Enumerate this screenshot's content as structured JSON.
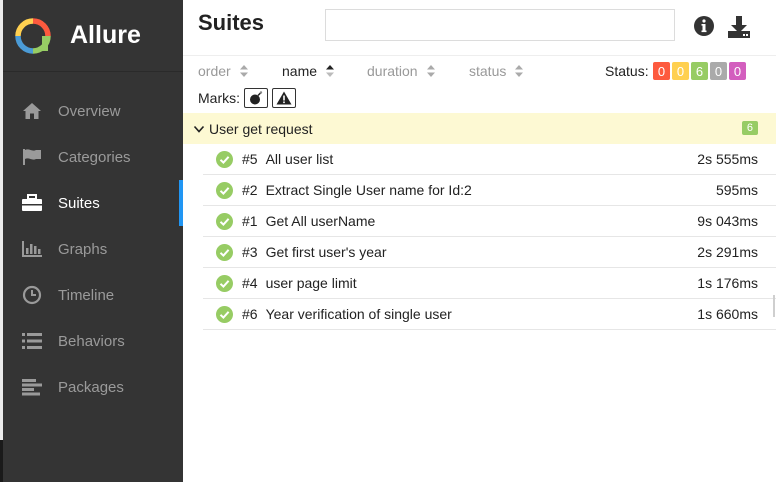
{
  "app": {
    "brand": "Allure"
  },
  "sidebar": {
    "items": [
      {
        "label": "Overview",
        "icon": "home-icon",
        "active": false
      },
      {
        "label": "Categories",
        "icon": "flag-icon",
        "active": false
      },
      {
        "label": "Suites",
        "icon": "briefcase-icon",
        "active": true
      },
      {
        "label": "Graphs",
        "icon": "bar-chart-icon",
        "active": false
      },
      {
        "label": "Timeline",
        "icon": "clock-icon",
        "active": false
      },
      {
        "label": "Behaviors",
        "icon": "list-icon",
        "active": false
      },
      {
        "label": "Packages",
        "icon": "align-left-icon",
        "active": false
      }
    ]
  },
  "header": {
    "title": "Suites",
    "search_value": ""
  },
  "toolbar": {
    "sort": [
      {
        "label": "order",
        "active": false
      },
      {
        "label": "name",
        "active": true
      },
      {
        "label": "duration",
        "active": false
      },
      {
        "label": "status",
        "active": false
      }
    ],
    "status_label": "Status:",
    "status_counts": [
      {
        "status": "failed",
        "count": "0",
        "color": "#fd5a3e"
      },
      {
        "status": "broken",
        "count": "0",
        "color": "#ffd050"
      },
      {
        "status": "passed",
        "count": "6",
        "color": "#97cc64"
      },
      {
        "status": "skipped",
        "count": "0",
        "color": "#aaaaaa"
      },
      {
        "status": "unknown",
        "count": "0",
        "color": "#d35ebe"
      }
    ],
    "marks_label": "Marks:"
  },
  "suite": {
    "name": "User get request",
    "count": "6",
    "tests": [
      {
        "num": "#5",
        "name": "All user list",
        "duration": "2s 555ms"
      },
      {
        "num": "#2",
        "name": "Extract Single User name for Id:2",
        "duration": "595ms"
      },
      {
        "num": "#1",
        "name": "Get All userName",
        "duration": "9s 043ms"
      },
      {
        "num": "#3",
        "name": "Get first user's year",
        "duration": "2s 291ms"
      },
      {
        "num": "#4",
        "name": "user page limit",
        "duration": "1s 176ms"
      },
      {
        "num": "#6",
        "name": "Year verification of single user",
        "duration": "1s 660ms"
      }
    ]
  },
  "colors": {
    "sidebar_bg": "#343434",
    "accent": "#2196f3",
    "passed": "#97cc64",
    "group_bg": "#fdf9d3"
  }
}
